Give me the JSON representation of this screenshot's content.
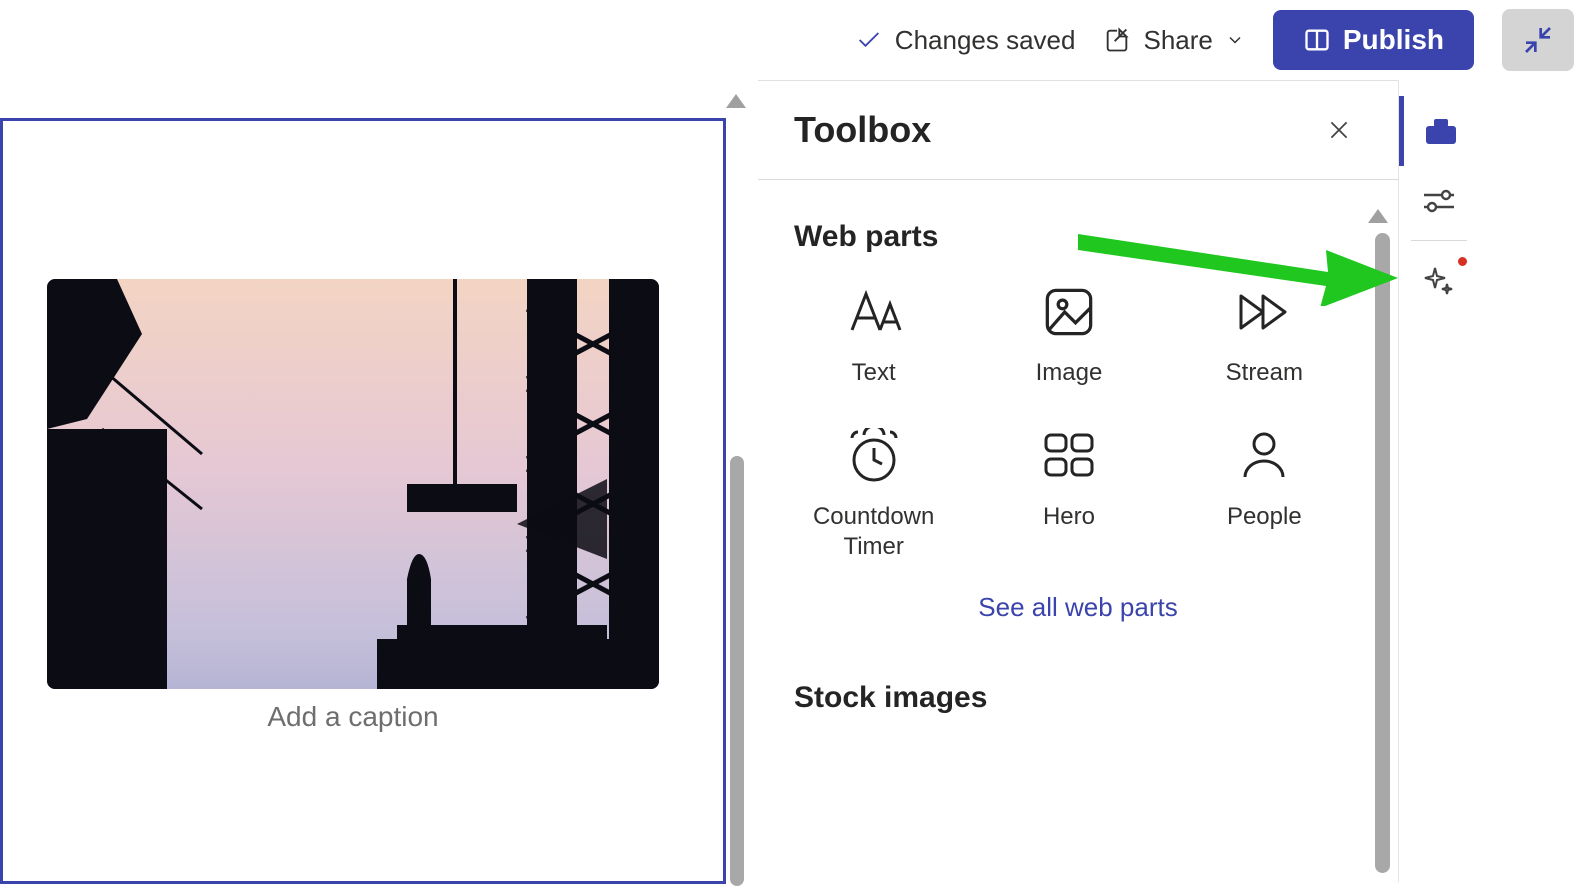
{
  "topbar": {
    "status_label": "Changes saved",
    "share_label": "Share",
    "publish_label": "Publish"
  },
  "canvas": {
    "caption_placeholder": "Add a caption"
  },
  "toolbox": {
    "title": "Toolbox",
    "sections": {
      "webparts_heading": "Web parts",
      "stockimages_heading": "Stock images"
    },
    "webparts": [
      {
        "label": "Text",
        "icon": "text-icon"
      },
      {
        "label": "Image",
        "icon": "image-icon"
      },
      {
        "label": "Stream",
        "icon": "stream-icon"
      },
      {
        "label": "Countdown Timer",
        "icon": "countdown-timer-icon"
      },
      {
        "label": "Hero",
        "icon": "hero-icon"
      },
      {
        "label": "People",
        "icon": "people-icon"
      }
    ],
    "see_all_label": "See all web parts"
  },
  "rail": {
    "items": [
      {
        "name": "toolbox",
        "active": true
      },
      {
        "name": "settings",
        "active": false
      },
      {
        "name": "design-ideas",
        "active": false,
        "notification": true
      }
    ]
  }
}
